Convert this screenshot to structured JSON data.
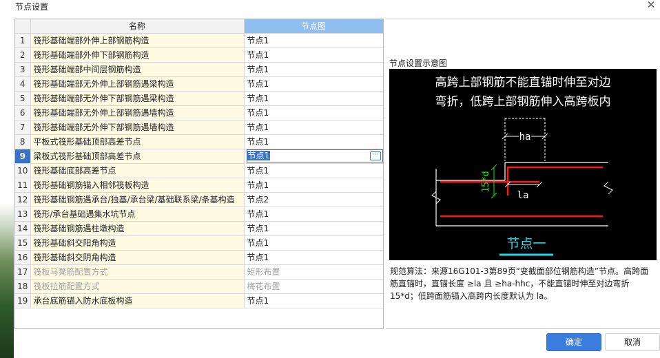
{
  "dialog": {
    "title": "节点设置"
  },
  "grid": {
    "col_name": "名称",
    "col_node": "节点图",
    "rows": [
      {
        "idx": "1",
        "name": "筏形基础端部外伸上部钢筋构造",
        "node": "节点1"
      },
      {
        "idx": "2",
        "name": "筏形基础端部外伸下部钢筋构造",
        "node": "节点1"
      },
      {
        "idx": "3",
        "name": "筏形基础端部中间层钢筋构造",
        "node": "节点1"
      },
      {
        "idx": "4",
        "name": "筏形基础端部无外伸上部钢筋遇梁构造",
        "node": "节点1"
      },
      {
        "idx": "5",
        "name": "筏形基础端部无外伸下部钢筋遇梁构造",
        "node": "节点1"
      },
      {
        "idx": "6",
        "name": "筏形基础端部无外伸上部钢筋遇墙构造",
        "node": "节点1"
      },
      {
        "idx": "7",
        "name": "筏形基础端部无外伸下部钢筋遇墙构造",
        "node": "节点1"
      },
      {
        "idx": "8",
        "name": "平板式筏形基础顶部高差节点",
        "node": "节点1"
      },
      {
        "idx": "9",
        "name": "梁板式筏形基础顶部高差节点",
        "node": "节点1"
      },
      {
        "idx": "10",
        "name": "筏形基础底部高差节点",
        "node": "节点1"
      },
      {
        "idx": "11",
        "name": "筏形基础钢筋锚入相邻筏板构造",
        "node": "节点1"
      },
      {
        "idx": "12",
        "name": "筏形基础钢筋遇承台/独基/承台梁/基础联系梁/条基构造",
        "node": "节点2"
      },
      {
        "idx": "13",
        "name": "筏形/承台基础遇集水坑节点",
        "node": "节点1"
      },
      {
        "idx": "14",
        "name": "筏形基础钢筋遇柱墩构造",
        "node": "节点1"
      },
      {
        "idx": "15",
        "name": "筏形基础斜交阳角构造",
        "node": "节点1"
      },
      {
        "idx": "16",
        "name": "筏形基础斜交阴角构造",
        "node": "节点1"
      },
      {
        "idx": "17",
        "name": "筏板马凳筋配置方式",
        "node": "矩形布置"
      },
      {
        "idx": "18",
        "name": "筏板拉筋配置方式",
        "node": "梅花布置"
      },
      {
        "idx": "19",
        "name": "承台底筋锚入防水底板构造",
        "node": "节点1"
      }
    ],
    "ellipsis": "···"
  },
  "preview": {
    "label": "节点设置示意图",
    "line1": "高跨上部钢筋不能直锚时伸至对边",
    "line2": "弯折，低跨上部钢筋伸入高跨板内",
    "dim_ha": "ha",
    "dim_15d": "15*d",
    "dim_la": "la",
    "node_name": "节点一",
    "colors": {
      "rebar": "#ff1a1a",
      "dim": "#1ee01e",
      "text": "#ffffff",
      "node": "#29d6e6"
    }
  },
  "description": "规范算法：来源16G101-3第89页“变截面部位钢筋构造”节点。高跨面筋直锚时，直锚长度 ≥la 且 ≥ha-hhc，不能直锚时伸至对边弯折15*d；低跨面筋锚入高跨内长度默认为 la。",
  "buttons": {
    "ok": "确定",
    "cancel": "取消"
  }
}
